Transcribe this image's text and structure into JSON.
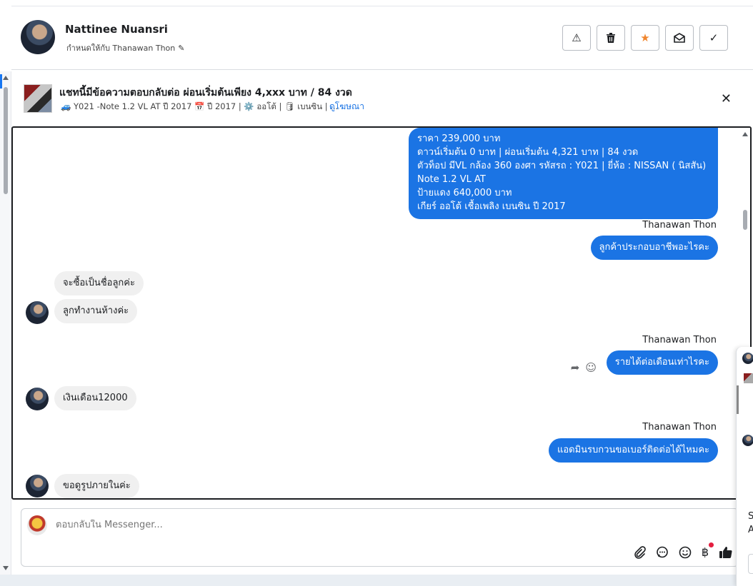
{
  "header": {
    "name": "Nattinee Nuansri",
    "assigned_to": "กำหนดให้กับ Thanawan Thon",
    "actions": [
      {
        "name": "report-icon",
        "glyph": "⚠"
      },
      {
        "name": "trash-icon",
        "glyph": "🗑"
      },
      {
        "name": "star-icon",
        "glyph": "★"
      },
      {
        "name": "mark-unread-icon",
        "glyph": "✉"
      },
      {
        "name": "check-icon",
        "glyph": "✓"
      }
    ]
  },
  "ad": {
    "title": "แชทนี้มีข้อความตอบกลับต่อ ผ่อนเริ่มต้นเพียง 4,xxx บาท / 84 งวด",
    "subtitle": "🚙 Y021 -Note 1.2 VL AT ปี 2017 📅 ปี 2017 | ⚙️ ออโต้ | 🛢 เบนซิน | ...",
    "link": "ดูโฆษณา",
    "close": "✕"
  },
  "messages": {
    "ad_bubble": [
      "ราคา 239,000 บาท",
      "ดาวน์เริ่มต้น 0 บาท | ผ่อนเริ่มต้น 4,321 บาท | 84 งวด",
      " ตัวท็อป มีVL กล้อง 360 องศา  รหัสรถ : Y021 |  ยี่ห้อ : NISSAN ( นิสสัน)",
      "Note 1.2 VL AT",
      " ป้ายแดง 640,000 บาท",
      " เกียร์ ออโต้  เชื้อเพลิง เบนซิน  ปี 2017"
    ],
    "sender": "Thanawan Thon",
    "out_1": "ลูกค้าประกอบอาชีพอะไรคะ",
    "in_1": "จะซื้อเป็นชื่อลูกค่ะ",
    "in_2": "ลูกทำงานห้างค่ะ",
    "out_2": "รายได้ต่อเดือนเท่าไรคะ",
    "in_3": "เงินเดือน12000",
    "out_3": "แอดมินรบกวนขอเบอร์ติดต่อได้ไหมคะ",
    "in_4": "ขอดูรูปภายในค่ะ"
  },
  "composer": {
    "placeholder": "ตอบกลับใน Messenger...",
    "tools": [
      "attach-icon",
      "chat-bubble-icon",
      "emoji-icon",
      "baht-icon",
      "thumbs-up-icon"
    ],
    "baht_glyph": "฿"
  },
  "edge_panel": {
    "letter_1": "S",
    "letter_2": "A"
  },
  "colors": {
    "brand_blue": "#1b74e4",
    "star_orange": "#f0852d",
    "incoming_bg": "#f0f0f0"
  }
}
